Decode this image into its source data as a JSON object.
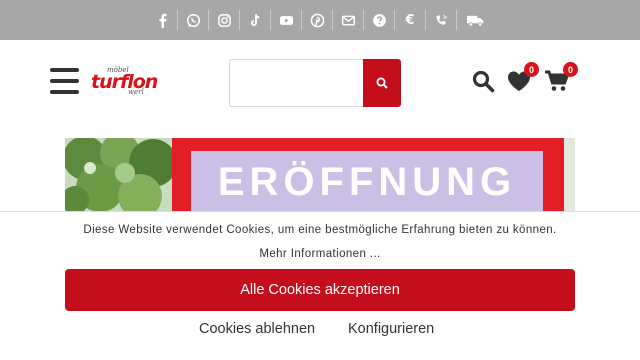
{
  "topbar": {
    "icons": [
      "facebook-icon",
      "whatsapp-icon",
      "instagram-icon",
      "tiktok-icon",
      "youtube-icon",
      "pinterest-icon",
      "mail-icon",
      "help-icon",
      "euro-icon",
      "phone-icon",
      "delivery-truck-icon"
    ],
    "euro_glyph": "€"
  },
  "header": {
    "logo": {
      "small_top": "möbel",
      "main": "turflon",
      "small_bottom": "werl"
    },
    "search": {
      "placeholder": "",
      "value": ""
    },
    "wishlist_count": "0",
    "cart_count": "0"
  },
  "banner": {
    "headline": "ERÖFFNUNG"
  },
  "cookie_banner": {
    "message": "Diese Website verwendet Cookies, um eine bestmögliche Erfahrung bieten zu können.",
    "more_info": "Mehr Informationen ...",
    "accept_label": "Alle Cookies akzeptieren",
    "reject_label": "Cookies ablehnen",
    "configure_label": "Konfigurieren"
  },
  "colors": {
    "topbar": "#a7a7a7",
    "brand_red": "#c40e1b",
    "banner_lilac": "#cbbfe6",
    "banner_red": "#e41e26"
  }
}
